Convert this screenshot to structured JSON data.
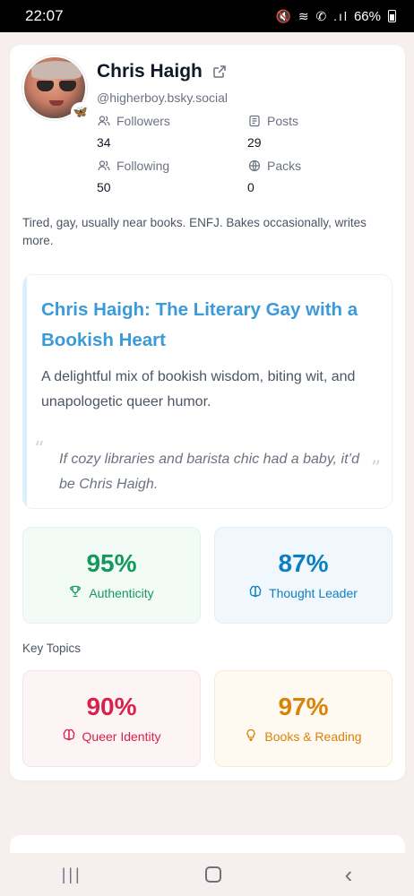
{
  "status_bar": {
    "time": "22:07",
    "icons": "🔇 ≋ ✆ .ıl",
    "battery": "66%"
  },
  "profile": {
    "name": "Chris Haigh",
    "handle": "@higherboy.bsky.social",
    "stats": {
      "followers": {
        "label": "Followers",
        "value": "34"
      },
      "posts": {
        "label": "Posts",
        "value": "29"
      },
      "following": {
        "label": "Following",
        "value": "50"
      },
      "packs": {
        "label": "Packs",
        "value": "0"
      }
    },
    "bio": "Tired, gay, usually near books. ENFJ. Bakes occasionally, writes more."
  },
  "summary": {
    "title": "Chris Haigh: The Literary Gay with a Bookish Heart",
    "description": "A delightful mix of bookish wisdom, biting wit, and unapologetic queer humor.",
    "quote": "If cozy libraries and barista chic had a baby, it’d be Chris Haigh.",
    "quote_open": "“",
    "quote_close": "”"
  },
  "metrics": [
    {
      "value": "95%",
      "label": "Authenticity",
      "icon": "trophy-icon",
      "color": "#14985b"
    },
    {
      "value": "87%",
      "label": "Thought Leader",
      "icon": "brain-icon",
      "color": "#0d7fc0"
    }
  ],
  "key_topics_label": "Key Topics",
  "topics": [
    {
      "value": "90%",
      "label": "Queer Identity",
      "icon": "brain-icon",
      "color": "#d6234a"
    },
    {
      "value": "97%",
      "label": "Books & Reading",
      "icon": "lightbulb-icon",
      "color": "#d98309"
    }
  ]
}
